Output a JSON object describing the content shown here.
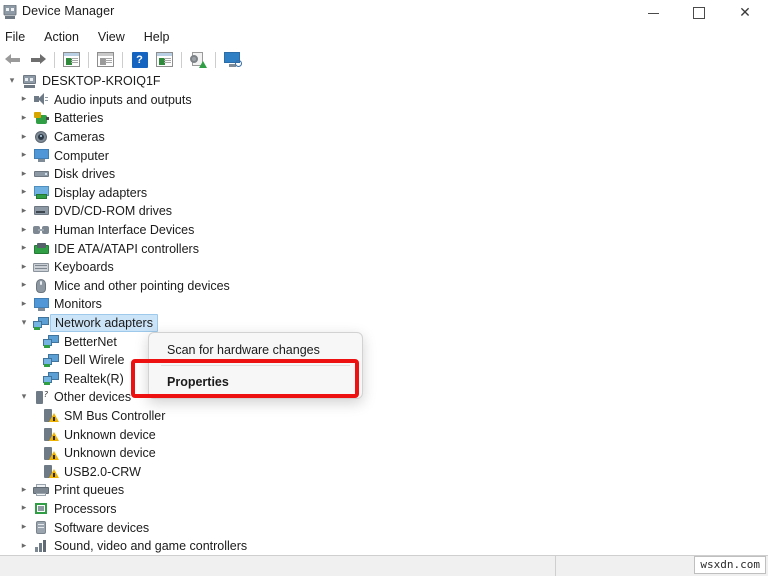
{
  "window": {
    "title": "Device Manager",
    "icon": "device-manager-icon",
    "controls": {
      "minimize": "minimize-button",
      "maximize": "maximize-button",
      "close": "close-button"
    }
  },
  "menubar": {
    "items": [
      {
        "label": "File"
      },
      {
        "label": "Action"
      },
      {
        "label": "View"
      },
      {
        "label": "Help"
      }
    ]
  },
  "toolbar": {
    "buttons": [
      {
        "name": "back-button",
        "icon": "back-arrow-icon"
      },
      {
        "name": "forward-button",
        "icon": "forward-arrow-icon"
      },
      {
        "name": "show-hide-console-tree-button",
        "icon": "console-tree-icon"
      },
      {
        "name": "properties-button",
        "icon": "properties-panel-icon"
      },
      {
        "name": "help-button",
        "icon": "help-question-icon"
      },
      {
        "name": "show-hide-action-pane-button",
        "icon": "action-pane-icon"
      },
      {
        "name": "update-driver-button",
        "icon": "update-driver-icon"
      },
      {
        "name": "scan-for-hardware-changes-button",
        "icon": "scan-monitor-icon"
      }
    ]
  },
  "tree": {
    "root": {
      "label": "DESKTOP-KROIQ1F",
      "icon": "computer-icon",
      "expanded": true
    },
    "nodes": [
      {
        "label": "Audio inputs and outputs",
        "icon": "speaker-icon",
        "expanded": false,
        "depth": 1
      },
      {
        "label": "Batteries",
        "icon": "battery-icon",
        "expanded": false,
        "depth": 1
      },
      {
        "label": "Cameras",
        "icon": "camera-icon",
        "expanded": false,
        "depth": 1
      },
      {
        "label": "Computer",
        "icon": "monitor-icon",
        "expanded": false,
        "depth": 1
      },
      {
        "label": "Disk drives",
        "icon": "disk-drive-icon",
        "expanded": false,
        "depth": 1
      },
      {
        "label": "Display adapters",
        "icon": "display-adapter-icon",
        "expanded": false,
        "depth": 1
      },
      {
        "label": "DVD/CD-ROM drives",
        "icon": "dvd-drive-icon",
        "expanded": false,
        "depth": 1
      },
      {
        "label": "Human Interface Devices",
        "icon": "hid-icon",
        "expanded": false,
        "depth": 1
      },
      {
        "label": "IDE ATA/ATAPI controllers",
        "icon": "ide-controller-icon",
        "expanded": false,
        "depth": 1
      },
      {
        "label": "Keyboards",
        "icon": "keyboard-icon",
        "expanded": false,
        "depth": 1
      },
      {
        "label": "Mice and other pointing devices",
        "icon": "mouse-icon",
        "expanded": false,
        "depth": 1
      },
      {
        "label": "Monitors",
        "icon": "monitor-icon",
        "expanded": false,
        "depth": 1
      },
      {
        "label": "Network adapters",
        "icon": "network-adapter-icon",
        "expanded": true,
        "depth": 1,
        "selected": true
      },
      {
        "label": "BetterNet",
        "icon": "network-adapter-icon",
        "depth": 2,
        "leaf": true
      },
      {
        "label": "Dell Wirele",
        "icon": "network-adapter-icon",
        "depth": 2,
        "leaf": true
      },
      {
        "label": "Realtek(R)",
        "icon": "network-adapter-icon",
        "depth": 2,
        "leaf": true
      },
      {
        "label": "Other devices",
        "icon": "unknown-device-icon",
        "expanded": true,
        "depth": 1
      },
      {
        "label": "SM Bus Controller",
        "icon": "warning-device-icon",
        "depth": 2,
        "leaf": true
      },
      {
        "label": "Unknown device",
        "icon": "warning-device-icon",
        "depth": 2,
        "leaf": true
      },
      {
        "label": "Unknown device",
        "icon": "warning-device-icon",
        "depth": 2,
        "leaf": true
      },
      {
        "label": "USB2.0-CRW",
        "icon": "warning-device-icon",
        "depth": 2,
        "leaf": true
      },
      {
        "label": "Print queues",
        "icon": "printer-icon",
        "expanded": false,
        "depth": 1
      },
      {
        "label": "Processors",
        "icon": "processor-icon",
        "expanded": false,
        "depth": 1
      },
      {
        "label": "Software devices",
        "icon": "software-device-icon",
        "expanded": false,
        "depth": 1
      },
      {
        "label": "Sound, video and game controllers",
        "icon": "sound-controller-icon",
        "expanded": false,
        "depth": 1
      }
    ]
  },
  "context_menu": {
    "items": [
      {
        "label": "Scan for hardware changes",
        "bold": false
      },
      {
        "label": "Properties",
        "bold": true
      }
    ]
  },
  "annotation": {
    "highlight_color": "#ee1111",
    "target": "Properties"
  },
  "watermark": {
    "text": "wsxdn.com"
  },
  "colors": {
    "selection": "#cce4f7",
    "selection_border": "#9ec9ea",
    "menu_bg": "#f7f7f7",
    "status_bg": "#f0f0f0",
    "annotation": "#ee1111"
  }
}
